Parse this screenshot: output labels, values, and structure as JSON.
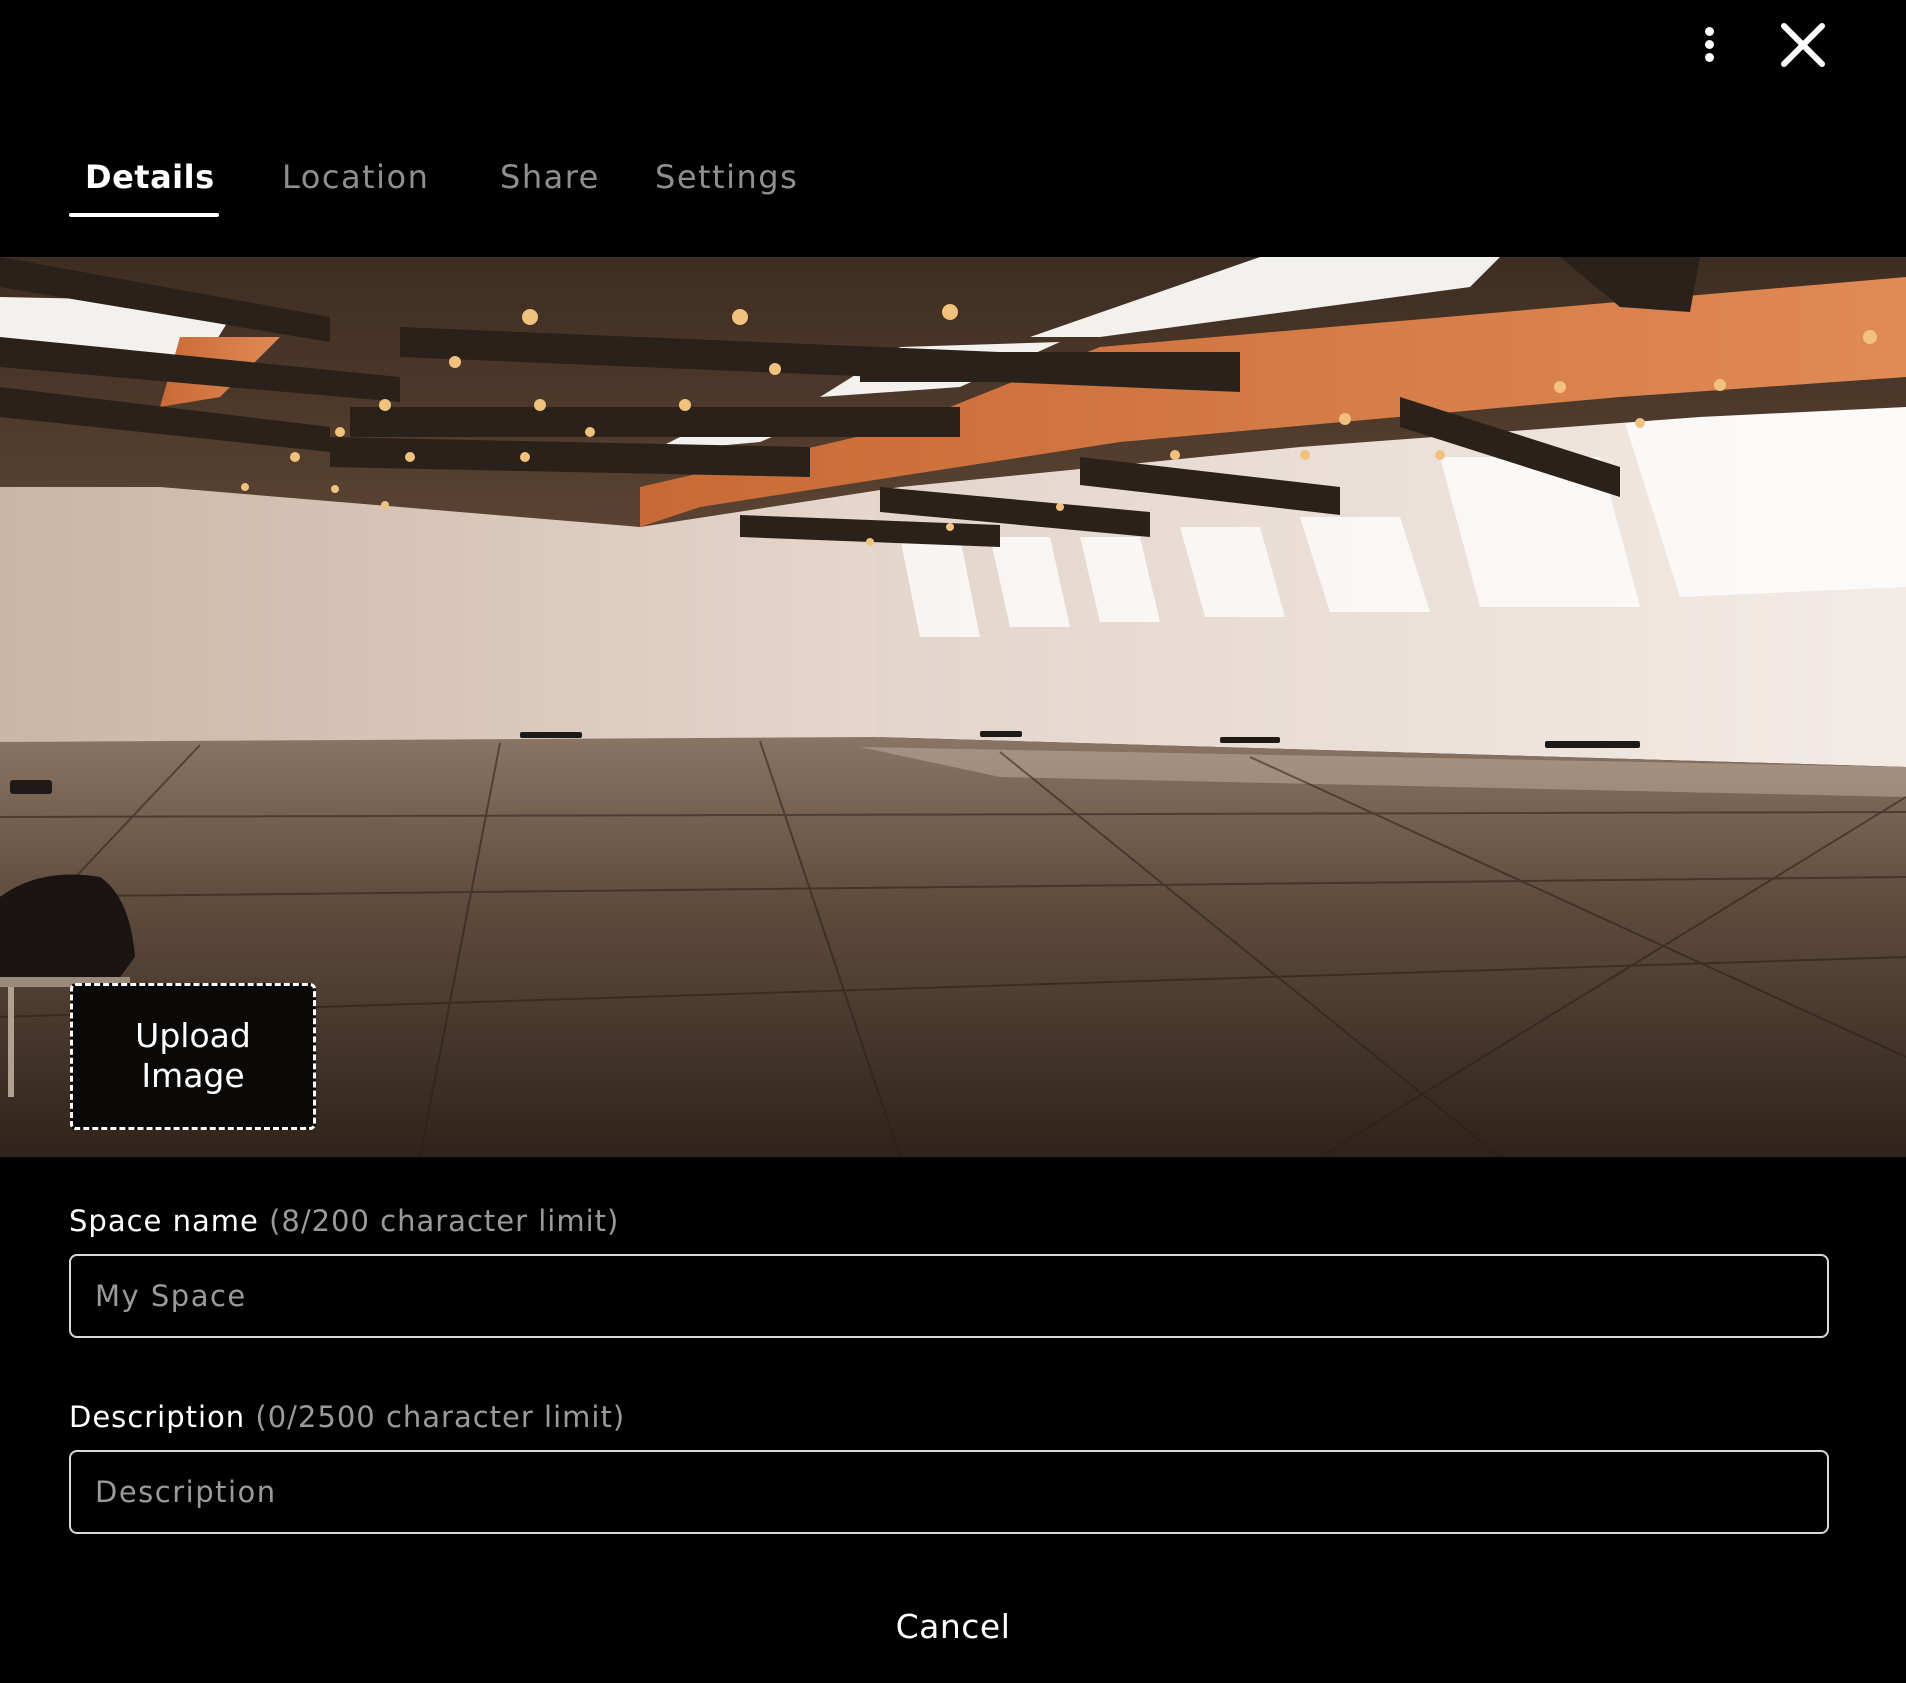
{
  "header": {
    "more_icon": "more-vertical-icon",
    "close_icon": "close-icon"
  },
  "tabs": [
    {
      "label": "Details",
      "active": true
    },
    {
      "label": "Location",
      "active": false
    },
    {
      "label": "Share",
      "active": false
    },
    {
      "label": "Settings",
      "active": false
    }
  ],
  "cover": {
    "upload_label_line1": "Upload",
    "upload_label_line2": "Image"
  },
  "form": {
    "space_name": {
      "label": "Space name",
      "hint": "(8/200 character limit)",
      "value": "My Space",
      "placeholder": "My Space"
    },
    "description": {
      "label": "Description",
      "hint": "(0/2500 character limit)",
      "value": "",
      "placeholder": "Description"
    }
  },
  "footer": {
    "cancel_label": "Cancel"
  }
}
